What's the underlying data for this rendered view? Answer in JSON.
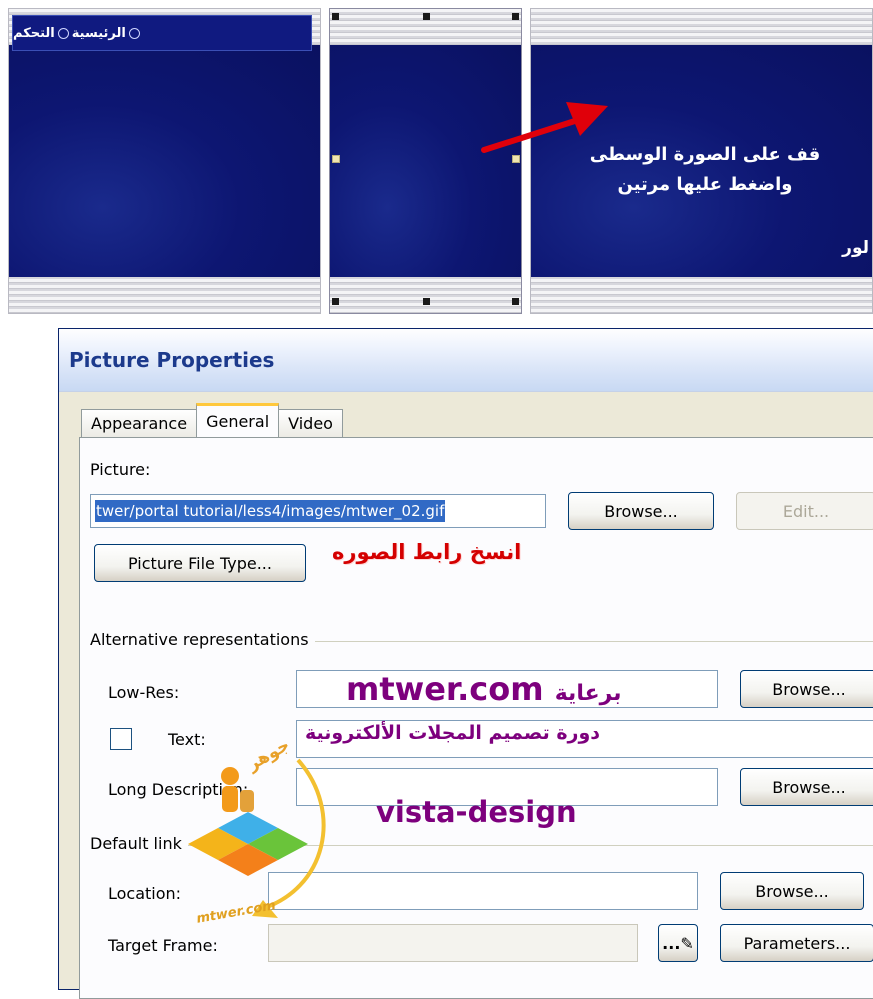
{
  "banner": {
    "nav": {
      "item1": "الرئيسية",
      "item2": "التحكم"
    },
    "instruction_line1": "قف على الصورة الوسطى",
    "instruction_line2": "واضغط عليها مرتين",
    "cut_word": "لور",
    "colors": {
      "navy": "#0d1672",
      "arrow": "#e0000a"
    }
  },
  "dialog": {
    "title": "Picture Properties",
    "tabs": [
      {
        "label": "Appearance",
        "active": false
      },
      {
        "label": "General",
        "active": true
      },
      {
        "label": "Video",
        "active": false
      }
    ],
    "picture": {
      "label": "Picture:",
      "value": "twer/portal tutorial/less4/images/mtwer_02.gif",
      "browse_label": "Browse...",
      "edit_label": "Edit...",
      "file_type_label": "Picture File Type..."
    },
    "alt": {
      "group_label": "Alternative representations",
      "lowres_label": "Low-Res:",
      "lowres_browse": "Browse...",
      "text_label": "Text:",
      "text_checked": false,
      "longdesc_label": "Long Description:",
      "longdesc_browse": "Browse..."
    },
    "default_link": {
      "group_label": "Default link",
      "location_label": "Location:",
      "location_browse": "Browse...",
      "target_label": "Target Frame:",
      "target_btn": "...",
      "parameters_label": "Parameters..."
    },
    "colors": {
      "face": "#ece9d8",
      "title_text": "#1c3a8c",
      "tab_highlight": "#ffc83c"
    }
  },
  "overlay": {
    "copy_link": "انسخ رابط الصوره",
    "brand_prefix": "برعاية",
    "brand_site": "mtwer.com",
    "course": "دورة تصميم المجلات الألكترونية",
    "vista": "vista-design",
    "logo_word": "جوهر",
    "logo_site": "mtwer.com",
    "colors": {
      "red": "#d40000",
      "purple": "#7d007d"
    }
  }
}
